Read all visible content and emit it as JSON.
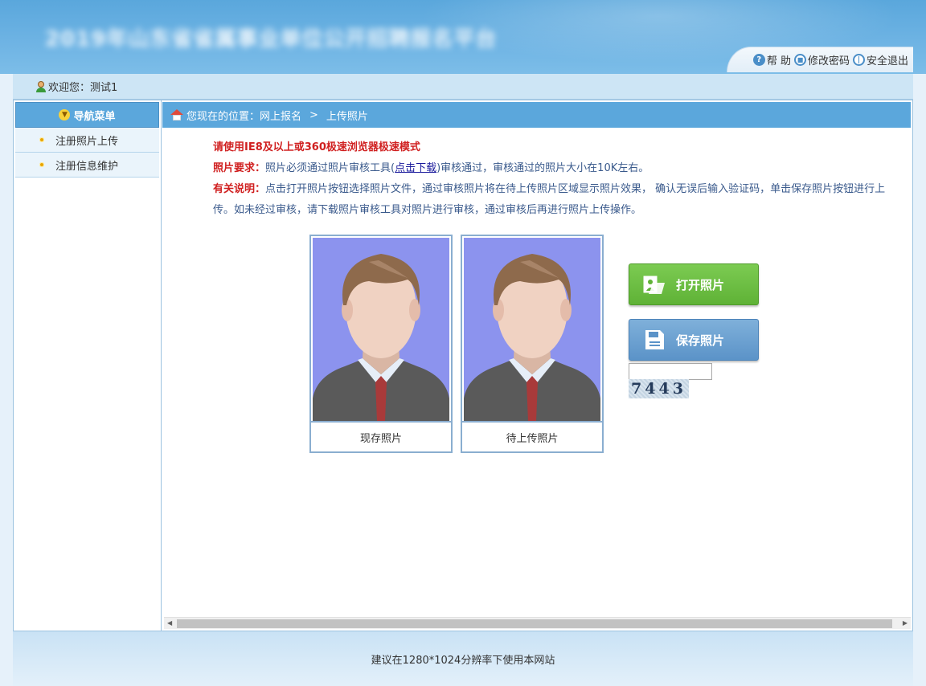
{
  "header": {
    "site_title": "2019年山东省省属事业单位公开招聘报名平台",
    "help_label": "帮 助",
    "change_password_label": "修改密码",
    "logout_label": "安全退出"
  },
  "welcome": {
    "text": "欢迎您：测试1"
  },
  "sidebar": {
    "title": "导航菜单",
    "items": [
      {
        "label": "注册照片上传"
      },
      {
        "label": "注册信息维护"
      }
    ]
  },
  "breadcrumb": {
    "prefix": "您现在的位置：网上报名",
    "separator": ">",
    "current": "上传照片"
  },
  "notice": {
    "browser_tip": "请使用IE8及以上或360极速浏览器极速模式",
    "photo_req_label": "照片要求：",
    "photo_req_text1": "照片必须通过照片审核工具(",
    "download_link": "点击下载",
    "photo_req_text2": ")审核通过，审核通过的照片大小在10K左右。",
    "explain_label": "有关说明：",
    "explain_text": "点击打开照片按钮选择照片文件，通过审核照片将在待上传照片区域显示照片效果， 确认无误后输入验证码，单击保存照片按钮进行上传。如未经过审核，请下载照片审核工具对照片进行审核，通过审核后再进行照片上传操作。"
  },
  "photos": {
    "current_caption": "现存照片",
    "pending_caption": "待上传照片"
  },
  "actions": {
    "open_label": "打开照片",
    "save_label": "保存照片",
    "captcha_value": "",
    "captcha_code": "7443"
  },
  "footer": {
    "text": "建议在1280*1024分辨率下使用本网站"
  },
  "colors": {
    "header_blue": "#5aa7dc",
    "nav_blue": "#5ba7dc",
    "warning_red": "#d02020",
    "open_green": "#6cbf44",
    "save_blue": "#6aa2d2",
    "photo_bg": "#8c93ee"
  }
}
